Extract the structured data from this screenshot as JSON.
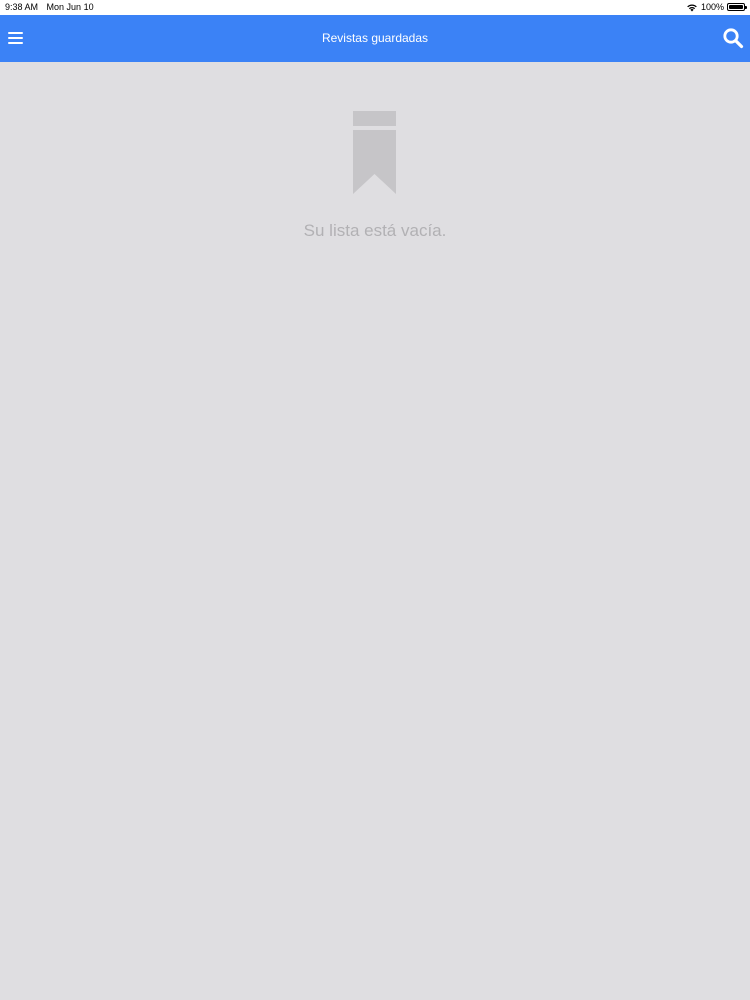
{
  "status_bar": {
    "time": "9:38 AM",
    "date": "Mon Jun 10",
    "battery": "100%",
    "wifi_icon": "wifi-icon",
    "battery_icon": "battery-icon"
  },
  "nav": {
    "title": "Revistas guardadas",
    "menu_icon": "hamburger-menu-icon",
    "search_icon": "search-icon"
  },
  "empty_state": {
    "icon": "bookmark-icon",
    "message": "Su lista está vacía."
  },
  "colors": {
    "nav_background": "#3b82f6",
    "page_background": "#dfdee1",
    "muted_text": "#b2b1b4",
    "icon_gray": "#c6c5c8"
  }
}
